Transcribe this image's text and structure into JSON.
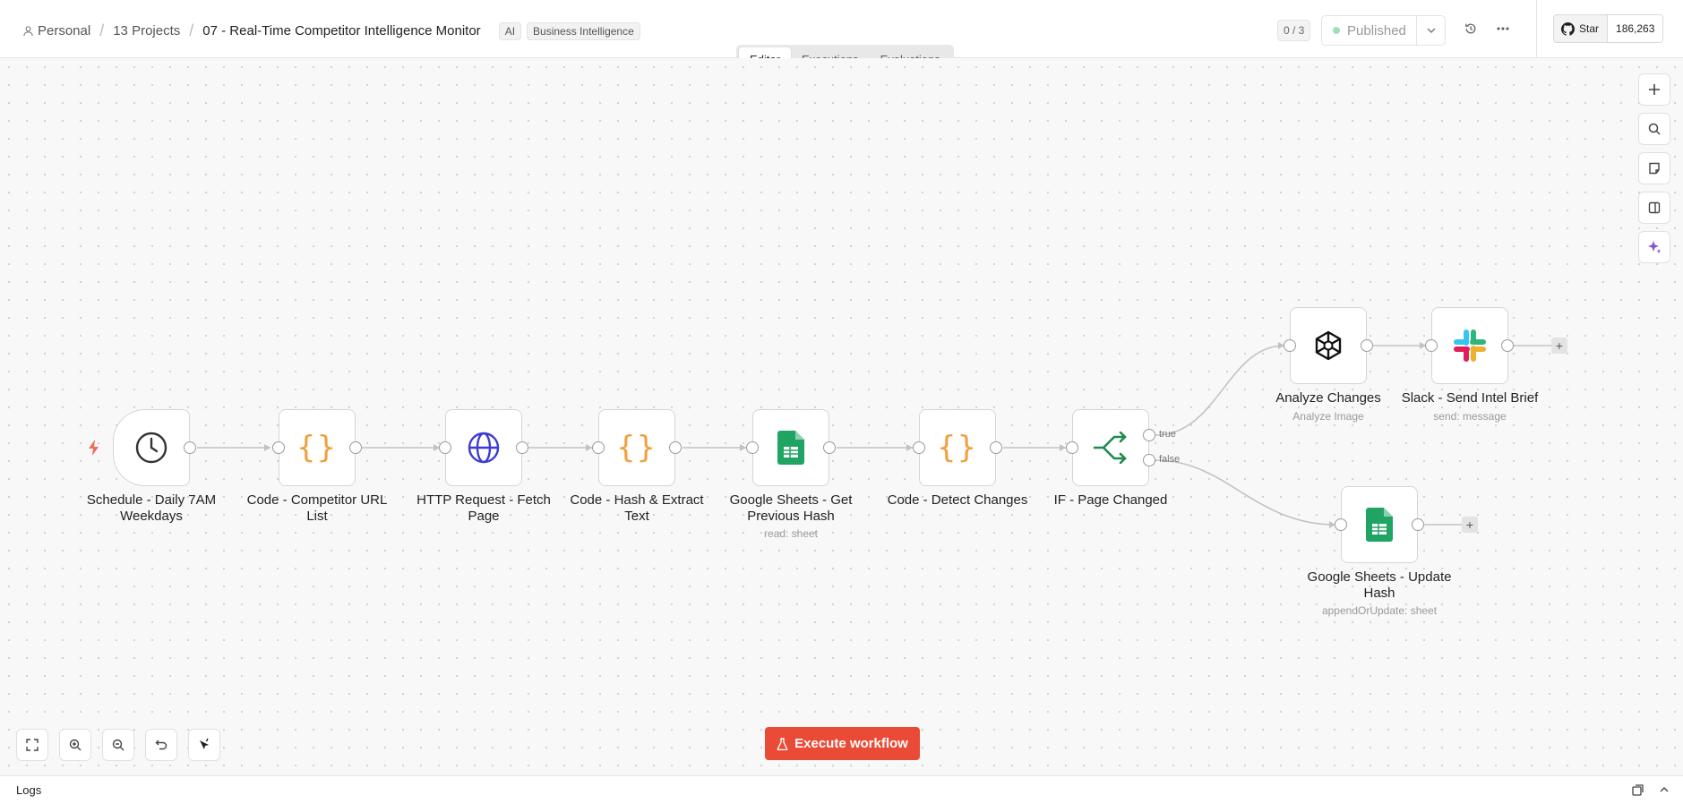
{
  "header": {
    "breadcrumb": {
      "personal": "Personal",
      "projects": "13 Projects",
      "title": "07 - Real-Time Competitor Intelligence Monitor"
    },
    "tags": [
      "AI",
      "Business Intelligence"
    ],
    "counter": "0 / 3",
    "publish_label": "Published",
    "github": {
      "star_label": "Star",
      "count": "186,263"
    }
  },
  "tabs": [
    "Editor",
    "Executions",
    "Evaluations"
  ],
  "nodes": [
    {
      "label": "Schedule - Daily 7AM Weekdays",
      "icon": "clock-icon",
      "sub": ""
    },
    {
      "label": "Code - Competitor URL List",
      "icon": "code-icon",
      "sub": ""
    },
    {
      "label": "HTTP Request - Fetch Page",
      "icon": "globe-icon",
      "sub": ""
    },
    {
      "label": "Code - Hash & Extract Text",
      "icon": "code-icon",
      "sub": ""
    },
    {
      "label": "Google Sheets - Get Previous Hash",
      "icon": "google-sheets-icon",
      "sub": "read: sheet"
    },
    {
      "label": "Code - Detect Changes",
      "icon": "code-icon",
      "sub": ""
    },
    {
      "label": "IF - Page Changed",
      "icon": "branch-icon",
      "sub": ""
    },
    {
      "label": "Analyze Changes",
      "icon": "openai-icon",
      "sub": "Analyze Image"
    },
    {
      "label": "Slack - Send Intel Brief",
      "icon": "slack-icon",
      "sub": "send: message"
    },
    {
      "label": "Google Sheets - Update Hash",
      "icon": "google-sheets-icon",
      "sub": "appendOrUpdate: sheet"
    }
  ],
  "branches": {
    "true_label": "true",
    "false_label": "false"
  },
  "execute_label": "Execute workflow",
  "logs_label": "Logs",
  "colors": {
    "accent": "#ea4b36",
    "code": "#f0a03c",
    "sheets": "#1fa463",
    "http": "#3b3bd6",
    "if": "#1f8a4c"
  }
}
